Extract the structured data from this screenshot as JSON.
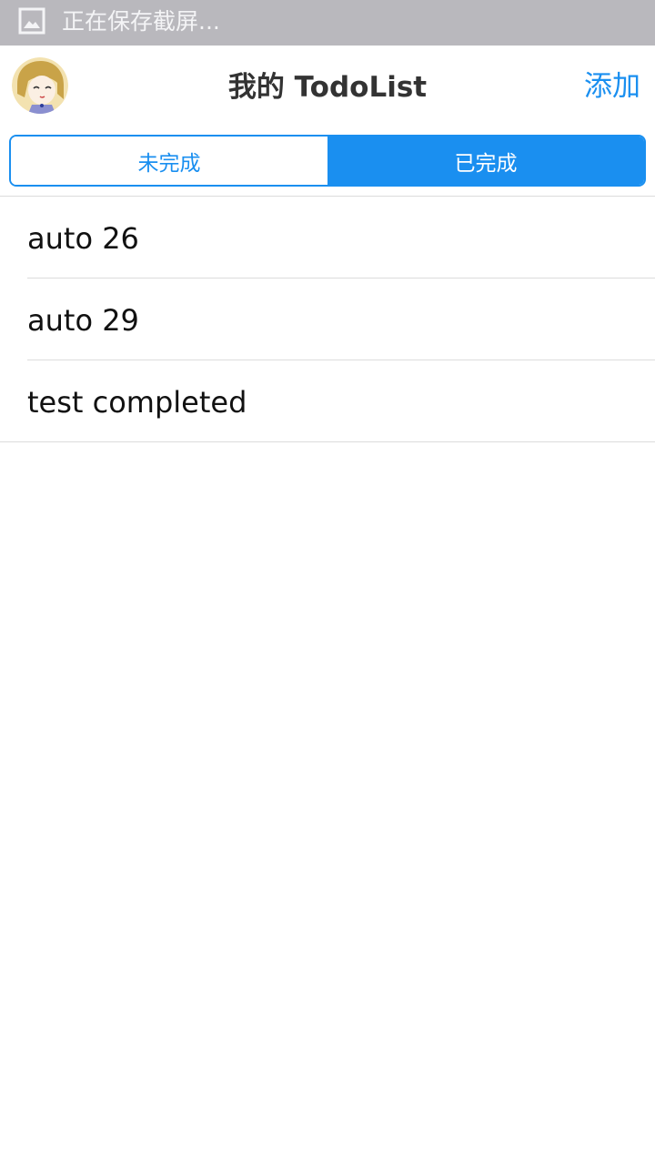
{
  "status_bar": {
    "icon": "image-icon",
    "text": "正在保存截屏..."
  },
  "header": {
    "avatar": "avatar",
    "title": "我的 TodoList",
    "add_label": "添加"
  },
  "tabs": [
    {
      "label": "未完成",
      "active": false
    },
    {
      "label": "已完成",
      "active": true
    }
  ],
  "todos": [
    {
      "label": "auto 26"
    },
    {
      "label": "auto 29"
    },
    {
      "label": "test completed"
    }
  ],
  "colors": {
    "accent": "#1a8ff0",
    "status_bar": "#b9b8bd",
    "divider": "#dcdcdc"
  }
}
